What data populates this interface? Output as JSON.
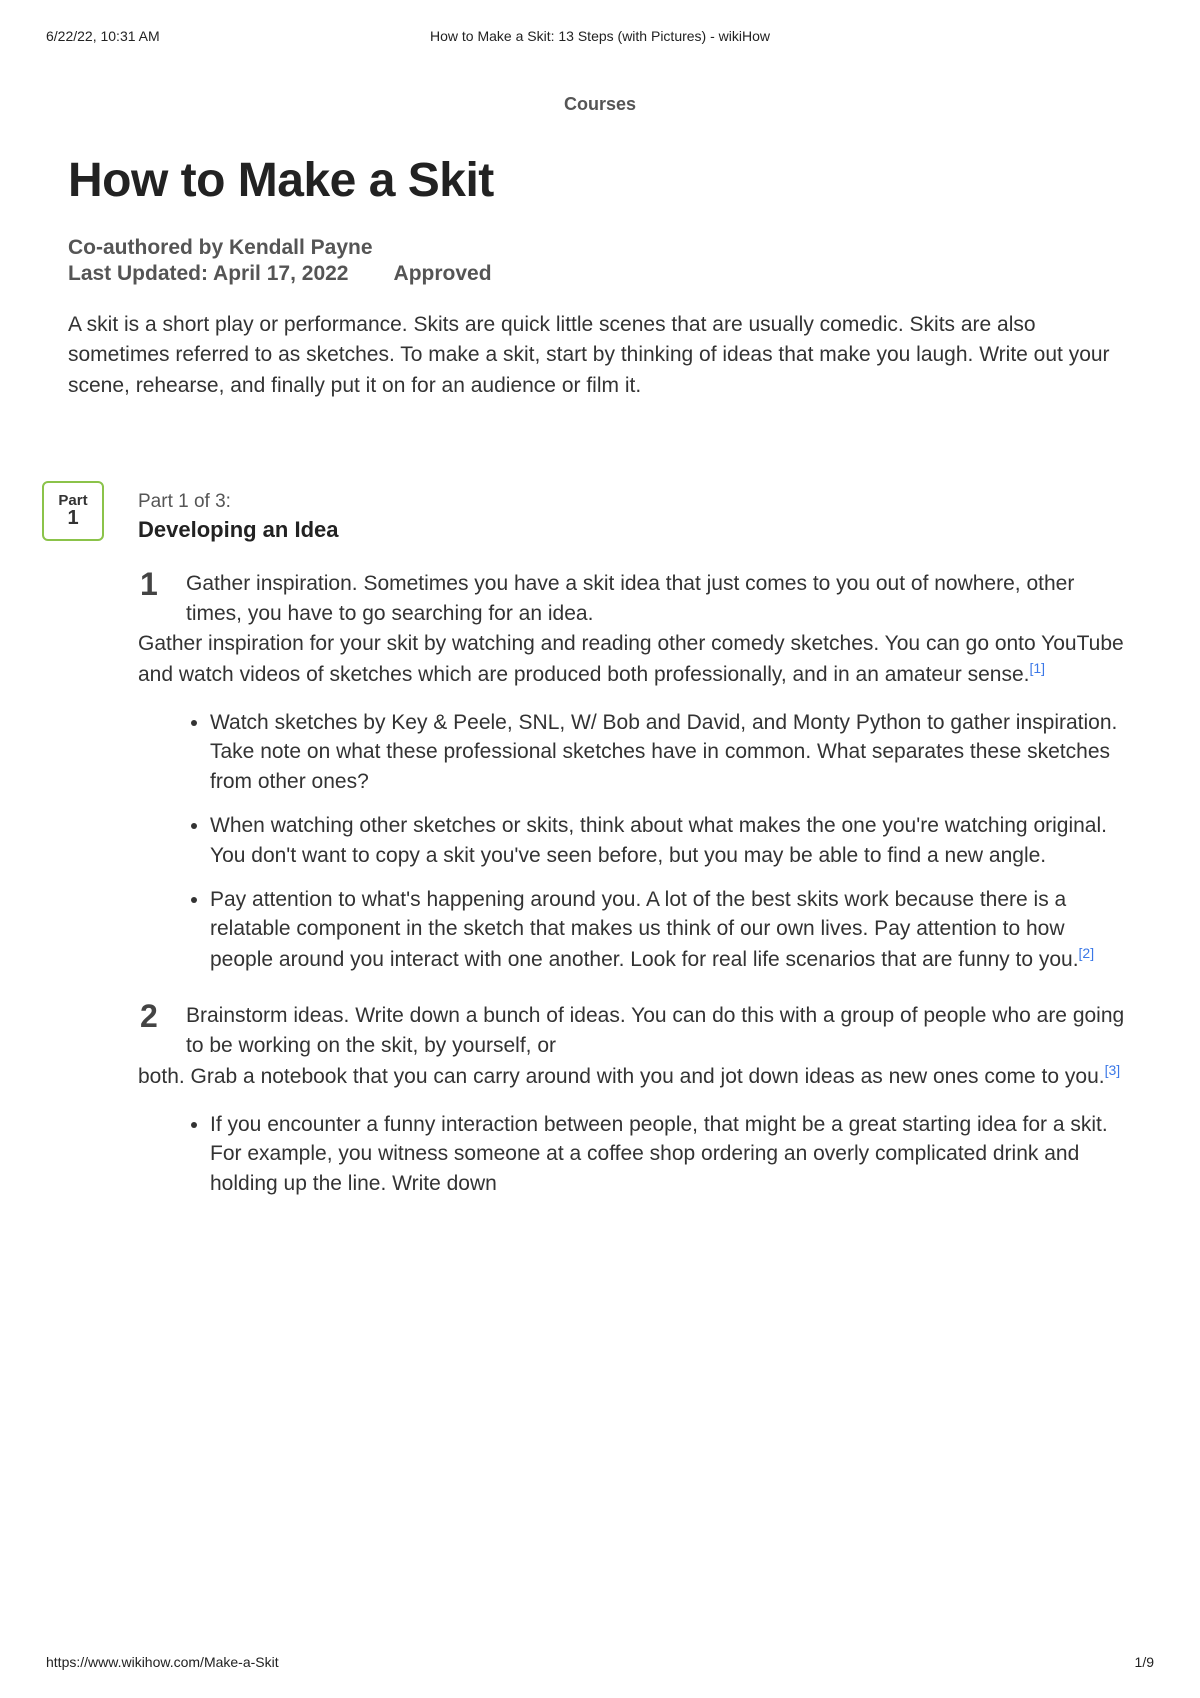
{
  "print": {
    "timestamp": "6/22/22, 10:31 AM",
    "docTitle": "How to Make a Skit: 13 Steps (with Pictures) - wikiHow",
    "url": "https://www.wikihow.com/Make-a-Skit",
    "page": "1/9"
  },
  "nav": {
    "courses": "Courses"
  },
  "article": {
    "title": "How to Make a Skit",
    "coauthored": "Co-authored by Kendall Payne",
    "updated": "Last Updated: April 17, 2022",
    "approved": "Approved",
    "intro": "A skit is a short play or performance. Skits are quick little scenes that are usually comedic. Skits are also sometimes referred to as sketches. To make a skit, start by thinking of ideas that make you laugh. Write out your scene, rehearse, and finally put it on for an audience or film it."
  },
  "partBadge": {
    "label": "Part",
    "num": "1"
  },
  "part1": {
    "eyebrow": "Part 1 of 3:",
    "title": "Developing an Idea"
  },
  "step1": {
    "num": "1",
    "title": "Gather inspiration. ",
    "bodyFirst": "Sometimes you have a skit idea that just comes to you out of nowhere, other times, you have to go searching for an idea.",
    "bodyRest": "Gather inspiration for your skit by watching and reading other comedy sketches. You can go onto YouTube and watch videos of sketches which are produced both professionally, and in an amateur sense.",
    "ref": "[1]",
    "bullets": [
      "Watch sketches by Key & Peele, SNL, W/ Bob and David, and Monty Python to gather inspiration. Take note on what these professional sketches have in common. What separates these sketches from other ones?",
      "When watching other sketches or skits, think about what makes the one you're watching original. You don't want to copy a skit you've seen before, but you may be able to find a new angle.",
      "Pay attention to what's happening around you. A lot of the best skits work because there is a relatable component in the sketch that makes us think of our own lives. Pay attention to how people around you interact with one another. Look for real life scenarios that are funny to you."
    ],
    "bullet3ref": "[2]"
  },
  "step2": {
    "num": "2",
    "title": "Brainstorm ideas. ",
    "bodyFirst": "Write down a bunch of ideas. You can do this with a group of people who are going to be working on the skit, by yourself, or",
    "bodyRest": "both. Grab a notebook that you can carry around with you and jot down ideas as new ones come to you.",
    "ref": "[3]",
    "bullets": [
      "If you encounter a funny interaction between people, that might be a great starting idea for a skit. For example, you witness someone at a coffee shop ordering an overly complicated drink and holding up the line. Write down"
    ]
  }
}
